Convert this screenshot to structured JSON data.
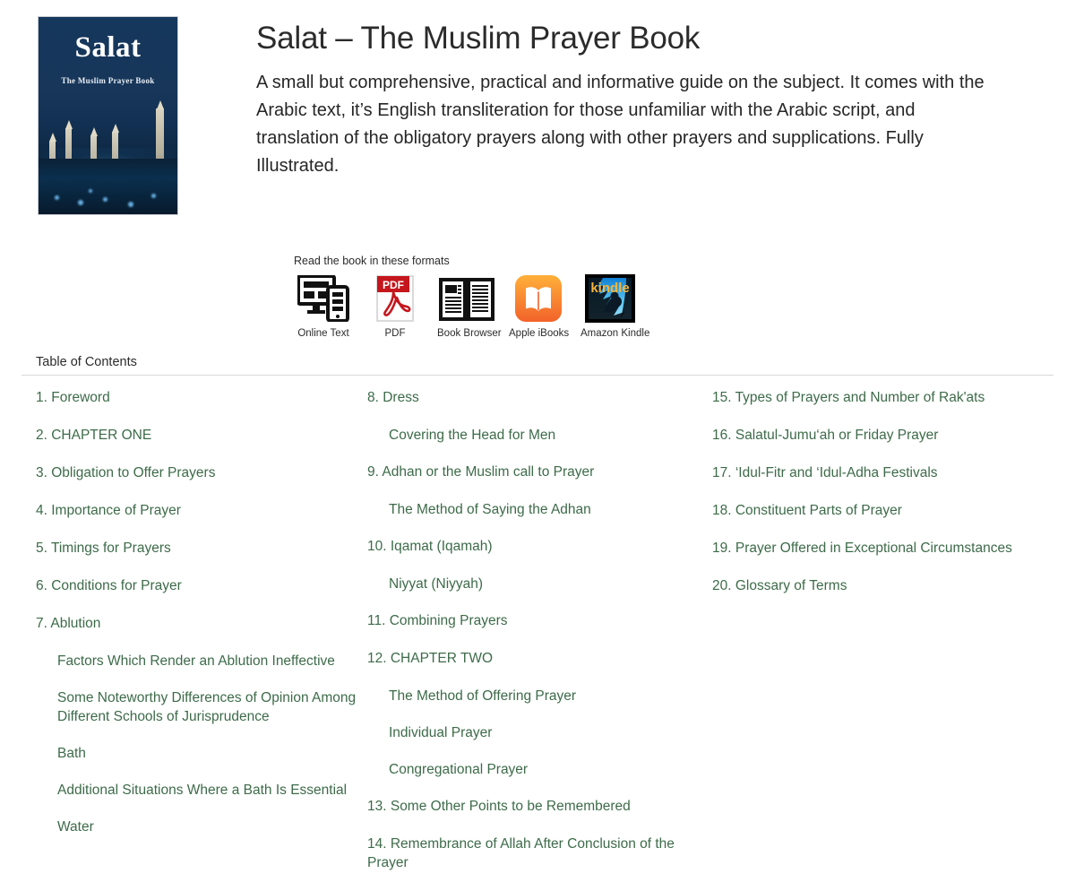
{
  "book": {
    "title": "Salat – The Muslim Prayer Book",
    "description": "A small but comprehensive, practical and informative guide on the subject. It comes with the Arabic text, it’s English transliteration for those unfamiliar with the Arabic script, and translation of the obligatory prayers along with other prayers and supplications. Fully Illustrated.",
    "cover": {
      "title": "Salat",
      "subtitle": "The Muslim Prayer Book"
    }
  },
  "formats": {
    "label": "Read the book in these formats",
    "items": [
      {
        "caption": "Online Text",
        "icon": "online-text-icon"
      },
      {
        "caption": "PDF",
        "icon": "pdf-icon"
      },
      {
        "caption": "Book Browser",
        "icon": "book-browser-icon"
      },
      {
        "caption": "Apple iBooks",
        "icon": "apple-ibooks-icon"
      },
      {
        "caption": "Amazon Kindle",
        "icon": "amazon-kindle-icon"
      }
    ]
  },
  "toc": {
    "heading": "Table of Contents",
    "link_color": "#3d6b49",
    "columns": [
      {
        "entries": [
          {
            "text": "1. Foreword",
            "sub": false
          },
          {
            "text": "2. CHAPTER ONE",
            "sub": false
          },
          {
            "text": "3. Obligation to Offer Prayers",
            "sub": false
          },
          {
            "text": "4. Importance of Prayer",
            "sub": false
          },
          {
            "text": "5. Timings for Prayers",
            "sub": false
          },
          {
            "text": "6. Conditions for Prayer",
            "sub": false
          },
          {
            "text": "7. Ablution",
            "sub": false
          },
          {
            "text": "Factors Which Render an Ablution Ineffective",
            "sub": true
          },
          {
            "text": "Some Noteworthy Differences of Opinion Among Different Schools of Jurisprudence",
            "sub": true
          },
          {
            "text": "Bath",
            "sub": true
          },
          {
            "text": "Additional Situations Where a Bath Is Essential",
            "sub": true
          },
          {
            "text": "Water",
            "sub": true
          }
        ]
      },
      {
        "entries": [
          {
            "text": "8. Dress",
            "sub": false
          },
          {
            "text": "Covering the Head for Men",
            "sub": true
          },
          {
            "text": "9. Adhan or the Muslim call to Prayer",
            "sub": false
          },
          {
            "text": "The Method of Saying the Adhan",
            "sub": true
          },
          {
            "text": "10. Iqamat (Iqamah)",
            "sub": false
          },
          {
            "text": "Niyyat (Niyyah)",
            "sub": true
          },
          {
            "text": "11. Combining Prayers",
            "sub": false
          },
          {
            "text": "12. CHAPTER TWO",
            "sub": false
          },
          {
            "text": "The Method of Offering Prayer",
            "sub": true
          },
          {
            "text": "Individual Prayer",
            "sub": true
          },
          {
            "text": "Congregational Prayer",
            "sub": true
          },
          {
            "text": "13. Some Other Points to be Remembered",
            "sub": false
          },
          {
            "text": "14. Remembrance of Allah After Conclusion of the Prayer",
            "sub": false
          }
        ]
      },
      {
        "entries": [
          {
            "text": "15. Types of Prayers and Number of Rak'ats",
            "sub": false
          },
          {
            "text": "16. Salatul-Jumu‘ah or Friday Prayer",
            "sub": false
          },
          {
            "text": "17. ‘Idul-Fitr and ‘Idul-Adha Festivals",
            "sub": false
          },
          {
            "text": "18. Constituent Parts of Prayer",
            "sub": false
          },
          {
            "text": "19. Prayer Offered in Exceptional Circumstances",
            "sub": false
          },
          {
            "text": "20. Glossary of Terms",
            "sub": false
          }
        ]
      }
    ]
  }
}
